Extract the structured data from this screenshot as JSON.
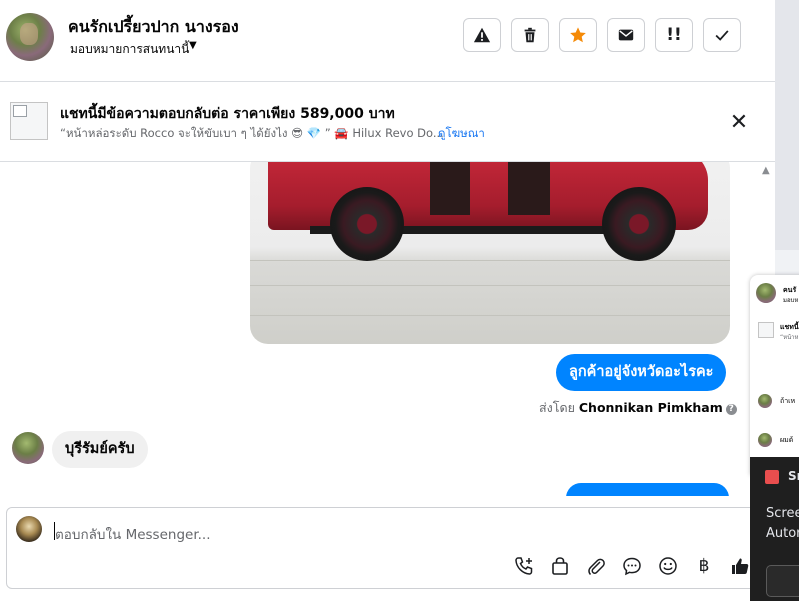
{
  "header": {
    "contact_name": "คนรักเปรี้ยวปาก นางรอง",
    "assign_label": "มอบหมายการสนทนานี้",
    "toolbar": [
      {
        "name": "report-spam-button",
        "icon": "alert-triangle-icon"
      },
      {
        "name": "delete-button",
        "icon": "trash-icon"
      },
      {
        "name": "star-button",
        "icon": "star-icon"
      },
      {
        "name": "mark-unread-button",
        "icon": "envelope-icon"
      },
      {
        "name": "follow-up-button",
        "icon": "exclamation-double-icon"
      },
      {
        "name": "mark-done-button",
        "icon": "check-icon"
      }
    ]
  },
  "ad_banner": {
    "title": "แชทนี้มีข้อความตอบกลับต่อ ราคาเพียง 589,000 บาท",
    "subtitle": "“หน้าหล่อระดับ Rocco จะให้ขับเบา ๆ ได้ยังไง 😎 💎 ” 🚘 Hilux Revo Do...",
    "link": "ดูโฆษณา"
  },
  "messages": {
    "outgoing_1": "ลูกค้าอยู่จังหวัดอะไรคะ",
    "sent_by_prefix": "ส่งโดย",
    "sent_by_name": "Chonnikan Pimkham",
    "incoming_1": "บุรีรัมย์ครับ"
  },
  "composer": {
    "placeholder": "ตอบกลับใน Messenger..."
  },
  "side_popup": {
    "name_fragment": "คนรั",
    "sub_fragment": "มอบห",
    "ad_fragment": "แชทนี้",
    "ad_fragment2": "“หน้าห",
    "row1": "ถ้าเห",
    "row2": "ผมด้",
    "dark_title": "Sn",
    "dark_line1": "Scree",
    "dark_line2": "Autor"
  },
  "colors": {
    "accent": "#0084ff",
    "link": "#1877f2",
    "star": "#f58a07"
  }
}
